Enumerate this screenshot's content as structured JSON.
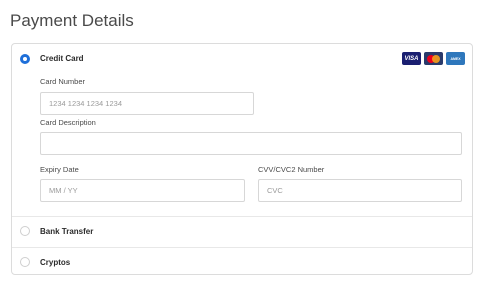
{
  "page": {
    "title": "Payment Details"
  },
  "options": {
    "credit_card": {
      "label": "Credit Card",
      "selected": true
    },
    "bank_transfer": {
      "label": "Bank Transfer",
      "selected": false
    },
    "cryptos": {
      "label": "Cryptos",
      "selected": false
    }
  },
  "card_logos": {
    "visa": {
      "text": "VISA",
      "icon": "visa-logo",
      "color": "#1a1f71"
    },
    "mastercard": {
      "icon": "mastercard-logo",
      "colors": [
        "#eb001b",
        "#f79e1b"
      ]
    },
    "amex": {
      "text": "AMEX",
      "icon": "amex-logo",
      "color": "#2e77bc"
    }
  },
  "form": {
    "card_number": {
      "label": "Card Number",
      "placeholder": "1234 1234 1234 1234",
      "value": ""
    },
    "card_description": {
      "label": "Card Description",
      "placeholder": "",
      "value": ""
    },
    "expiry": {
      "label": "Expiry Date",
      "placeholder": "MM / YY",
      "value": ""
    },
    "cvc": {
      "label": "CVV/CVC2 Number",
      "placeholder": "CVC",
      "value": ""
    }
  },
  "colors": {
    "accent": "#1e6fd9",
    "border": "#dcdcdc"
  }
}
